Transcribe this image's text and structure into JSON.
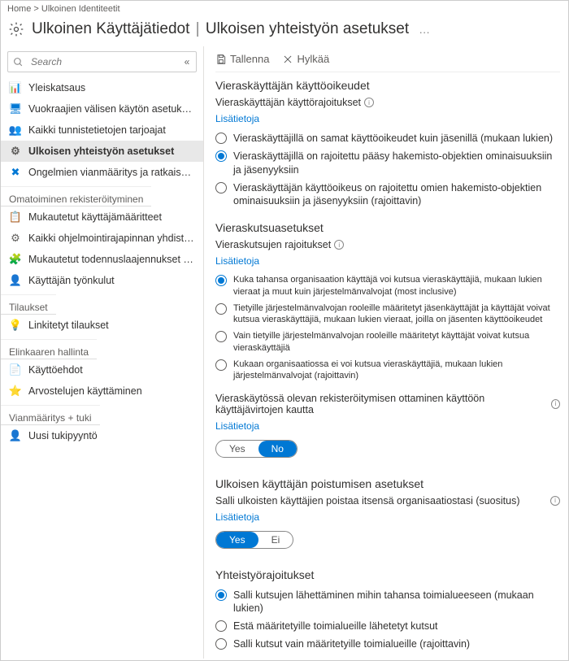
{
  "breadcrumb": {
    "home": "Home >",
    "current": "Ulkoinen Identiteetit"
  },
  "header": {
    "title1": "Ulkoinen",
    "title2": "Käyttäjätiedot",
    "sep": "|",
    "title3": "Ulkoisen yhteistyön asetukset",
    "ellipsis": "…"
  },
  "search": {
    "placeholder": "Search"
  },
  "sidebar": {
    "items_top": [
      {
        "icon": "📊",
        "label": "Yleiskatsaus",
        "color": "#0078d4"
      },
      {
        "icon": "🖥",
        "label": "Vuokraajien välisen käytön asetukset",
        "color": "#0078d4"
      },
      {
        "icon": "👥",
        "label": "Kaikki tunnistetietojen tarjoajat",
        "color": "#0078d4"
      },
      {
        "icon": "⚙",
        "label": "Ulkoisen yhteistyön asetukset",
        "color": "#605e5c",
        "selected": true
      },
      {
        "icon": "✖",
        "label": "Ongelmien vianmääritys ja ratkaiseminen",
        "color": "#0078d4"
      }
    ],
    "group_self": "Omatoiminen rekisteröityminen",
    "items_self": [
      {
        "icon": "📋",
        "label": "Mukautetut käyttäjämääritteet",
        "color": "#0078d4"
      },
      {
        "icon": "⚙",
        "label": "Kaikki ohjelmointirajapinnan yhdistimet",
        "color": "#605e5c"
      },
      {
        "icon": "🧩",
        "label": "Mukautetut todennuslaajennukset (esikatselu)",
        "color": "#0078d4"
      },
      {
        "icon": "👤",
        "label": "Käyttäjän työnkulut",
        "color": "#0078d4"
      }
    ],
    "group_subs": "Tilaukset",
    "items_subs": [
      {
        "icon": "💡",
        "label": "Linkitetyt tilaukset",
        "color": "#f2c811"
      }
    ],
    "group_life": "Elinkaaren hallinta",
    "items_life": [
      {
        "icon": "📄",
        "label": "Käyttöehdot",
        "color": "#0078d4"
      },
      {
        "icon": "⭐",
        "label": "Arvostelujen käyttäminen",
        "color": "#0078d4"
      }
    ],
    "group_diag": "Vianmääritys + tuki",
    "items_diag": [
      {
        "icon": "👤",
        "label": "Uusi tukipyyntö",
        "color": "#0078d4"
      }
    ]
  },
  "toolbar": {
    "save": "Tallenna",
    "discard": "Hylkää"
  },
  "sections": {
    "guest_rights": {
      "heading": "Vieraskäyttäjän käyttöoikeudet",
      "sub": "Vieraskäyttäjän käyttörajoitukset",
      "learn": "Lisätietoja",
      "opts": [
        "Vieraskäyttäjillä on samat käyttöoikeudet kuin jäsenillä (mukaan lukien)",
        "Vieraskäyttäjillä on rajoitettu pääsy hakemisto-objektien ominaisuuksiin ja jäsenyyksiin",
        "Vieraskäyttäjän käyttöoikeus on rajoitettu omien hakemisto-objektien ominaisuuksiin ja jäsenyyksiin (rajoittavin)"
      ],
      "selected": 1
    },
    "invite": {
      "heading": "Vieraskutsuasetukset",
      "sub": "Vieraskutsujen rajoitukset",
      "learn": "Lisätietoja",
      "opts": [
        "Kuka tahansa organisaation käyttäjä voi kutsua vieraskäyttäjiä, mukaan lukien vieraat ja muut kuin järjestelmänvalvojat (most inclusive)",
        "Tietyille järjestelmänvalvojan rooleille määritetyt jäsenkäyttäjät ja käyttäjät voivat kutsua vieraskäyttäjiä, mukaan lukien vieraat, joilla on jäsenten käyttöoikeudet",
        "Vain tietyille järjestelmänvalvojan rooleille määritetyt käyttäjät voivat kutsua vieraskäyttäjiä",
        "Kukaan organisaatiossa ei voi kutsua vieraskäyttäjiä, mukaan lukien järjestelmänvalvojat (rajoittavin)"
      ],
      "selected": 0,
      "signup_label": "Vieraskäytössä olevan rekisteröitymisen ottaminen käyttöön käyttäjävirtojen kautta",
      "signup_learn": "Lisätietoja",
      "toggle_yes": "Yes",
      "toggle_no": "No",
      "toggle_on": "no"
    },
    "leave": {
      "heading": "Ulkoisen käyttäjän poistumisen asetukset",
      "sub": "Salli ulkoisten käyttäjien poistaa itsensä organisaatiostasi (suositus)",
      "learn": "Lisätietoja",
      "toggle_yes": "Yes",
      "toggle_no": "Ei",
      "toggle_on": "yes"
    },
    "collab": {
      "heading": "Yhteistyörajoitukset",
      "opts": [
        "Salli kutsujen lähettäminen mihin tahansa toimialueeseen (mukaan lukien)",
        "Estä määritetyille toimialueille lähetetyt kutsut",
        "Salli kutsut vain määritetyille toimialueille (rajoittavin)"
      ],
      "selected": 0
    }
  }
}
